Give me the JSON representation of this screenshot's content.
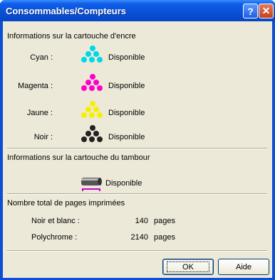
{
  "window": {
    "title": "Consommables/Compteurs",
    "help_glyph": "?",
    "close_glyph": "✕"
  },
  "ink": {
    "section_title": "Informations sur la cartouche d'encre",
    "items": [
      {
        "label": "Cyan :",
        "status": "Disponible",
        "color": "#00d8e8"
      },
      {
        "label": "Magenta :",
        "status": "Disponible",
        "color": "#ff00c8"
      },
      {
        "label": "Jaune :",
        "status": "Disponible",
        "color": "#f4f000"
      },
      {
        "label": "Noir :",
        "status": "Disponible",
        "color": "#222222"
      }
    ]
  },
  "drum": {
    "section_title": "Informations sur la cartouche du tambour",
    "status": "Disponible"
  },
  "counters": {
    "section_title": "Nombre total de pages imprimées",
    "rows": [
      {
        "label": "Noir et blanc :",
        "value": "140",
        "unit": "pages"
      },
      {
        "label": "Polychrome :",
        "value": "2140",
        "unit": "pages"
      }
    ]
  },
  "buttons": {
    "ok": "OK",
    "aide": "Aide"
  }
}
